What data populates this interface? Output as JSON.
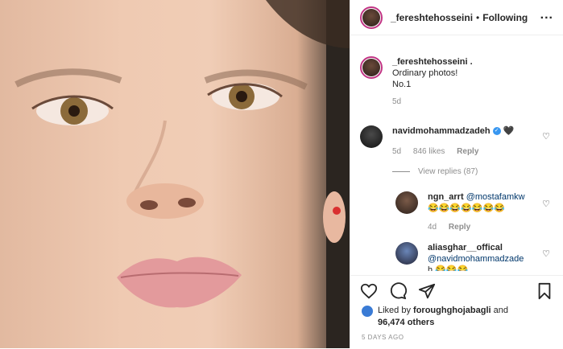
{
  "post": {
    "username": "_fereshtehosseini",
    "separator": "•",
    "follow_status": "Following",
    "more_icon": "..."
  },
  "caption": {
    "username": "_fereshtehosseini .",
    "line1": "Ordinary photos!",
    "line2": "No.1",
    "age": "5d"
  },
  "comments": [
    {
      "username": "navidmohammadzadeh",
      "text": "🖤",
      "age": "5d",
      "likes": "846 likes",
      "reply": "Reply",
      "view_replies": "View replies (87)"
    },
    {
      "username": "ngn_arrt",
      "mention": "@mostafamkw",
      "text": "😂😂😂😂😂😂😂",
      "age": "4d",
      "reply": "Reply"
    },
    {
      "username": "aliasghar__offical",
      "mention": "@navidmohammadzade",
      "text": "h 😂😂😂"
    }
  ],
  "likes": {
    "prefix": "Liked by",
    "user": "foroughghojabagli",
    "and": "and",
    "others": "96,474 others"
  },
  "time_ago": "5 DAYS AGO",
  "colors": {
    "link": "#00376b",
    "muted": "#8e8e8e",
    "verified": "#3897f0"
  }
}
